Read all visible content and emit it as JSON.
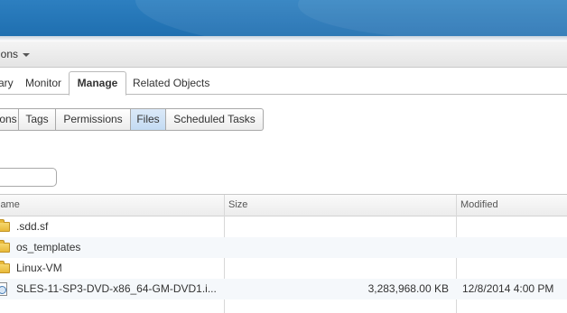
{
  "actions": {
    "label": "ions"
  },
  "tabs": [
    {
      "label": "ary"
    },
    {
      "label": "Monitor"
    },
    {
      "label": "Manage"
    },
    {
      "label": "Related Objects"
    }
  ],
  "subtabs": [
    {
      "label": "ons"
    },
    {
      "label": "Tags"
    },
    {
      "label": "Permissions"
    },
    {
      "label": "Files"
    },
    {
      "label": "Scheduled Tasks"
    }
  ],
  "search": {
    "value": "",
    "placeholder": ""
  },
  "grid": {
    "columns": {
      "name": "lame",
      "size": "Size",
      "modified": "Modified"
    },
    "rows": [
      {
        "icon": "folder-icon",
        "name": ".sdd.sf",
        "size": "",
        "modified": ""
      },
      {
        "icon": "folder-icon",
        "name": "os_templates",
        "size": "",
        "modified": ""
      },
      {
        "icon": "folder-icon",
        "name": "Linux-VM",
        "size": "",
        "modified": ""
      },
      {
        "icon": "disc-image-icon",
        "name": "SLES-11-SP3-DVD-x86_64-GM-DVD1.i...",
        "size": "3,283,968.00 KB",
        "modified": "12/8/2014 4:00 PM"
      }
    ]
  },
  "colors": {
    "banner": "#1f6fb0",
    "selected_subtab": "#c3dbf3",
    "alt_row": "#f5f8fb"
  }
}
